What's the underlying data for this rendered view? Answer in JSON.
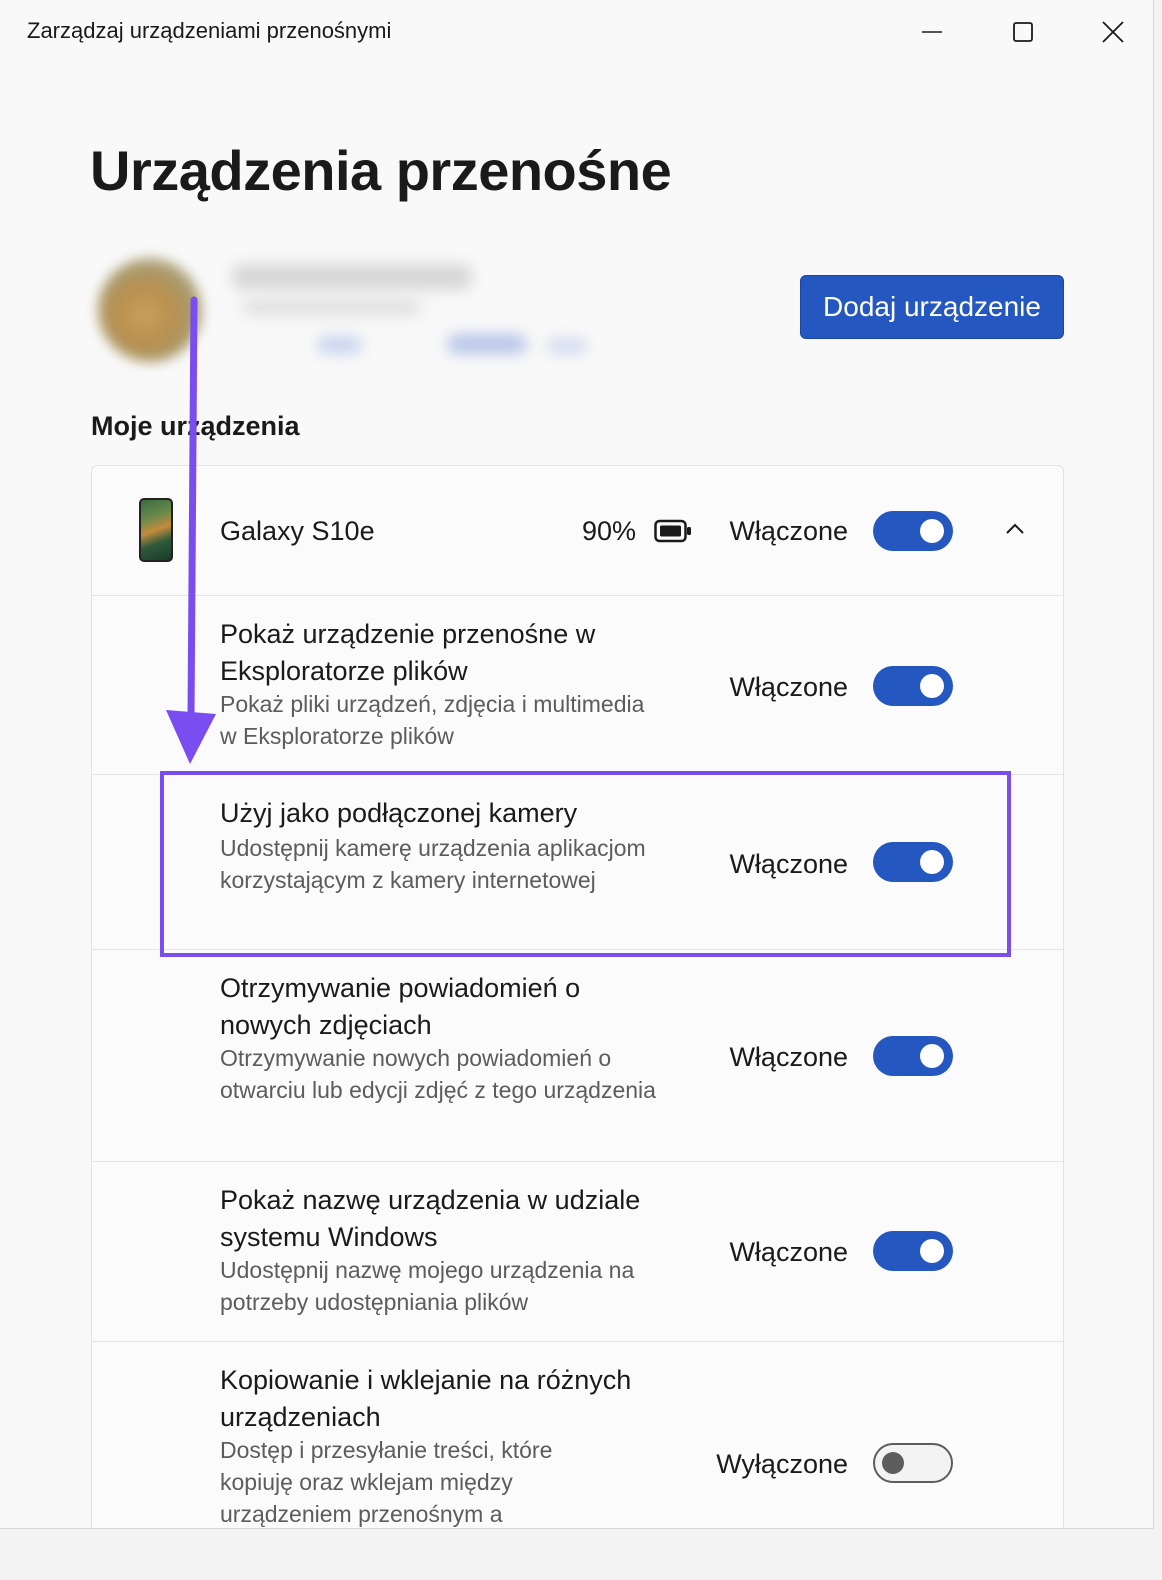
{
  "window": {
    "title": "Zarządzaj urządzeniami przenośnymi",
    "controls": [
      "minimize-icon",
      "maximize-icon",
      "close-icon"
    ]
  },
  "page_title": "Urządzenia przenośne",
  "add_device_button": "Dodaj urządzenie",
  "section_title": "Moje urządzenia",
  "device": {
    "name": "Galaxy S10e",
    "battery": "90%",
    "state": "Włączone",
    "toggle_on": true,
    "expanded": true
  },
  "settings": [
    {
      "title": "Pokaż urządzenie przenośne w Eksploratorze plików",
      "description": "Pokaż pliki urządzeń, zdjęcia i multimedia w Eksploratorze plików",
      "state": "Włączone",
      "on": true
    },
    {
      "title": "Użyj jako podłączonej kamery",
      "description": "Udostępnij kamerę urządzenia aplikacjom korzystającym z kamery internetowej",
      "state": "Włączone",
      "on": true
    },
    {
      "title": "Otrzymywanie powiadomień o nowych zdjęciach",
      "description": "Otrzymywanie nowych powiadomień o otwarciu lub edycji zdjęć z tego urządzenia",
      "state": "Włączone",
      "on": true
    },
    {
      "title": "Pokaż nazwę urządzenia w udziale systemu Windows",
      "description": "Udostępnij nazwę mojego urządzenia na potrzeby udostępniania plików",
      "state": "Włączone",
      "on": true
    },
    {
      "title": "Kopiowanie i wklejanie na różnych urządzeniach",
      "description": "Dostęp i przesyłanie treści, które kopiuję oraz wklejam między urządzeniem przenośnym a",
      "state": "Wyłączone",
      "on": false
    }
  ],
  "colors": {
    "accent": "#2457c0",
    "highlight": "#7a4df0"
  }
}
